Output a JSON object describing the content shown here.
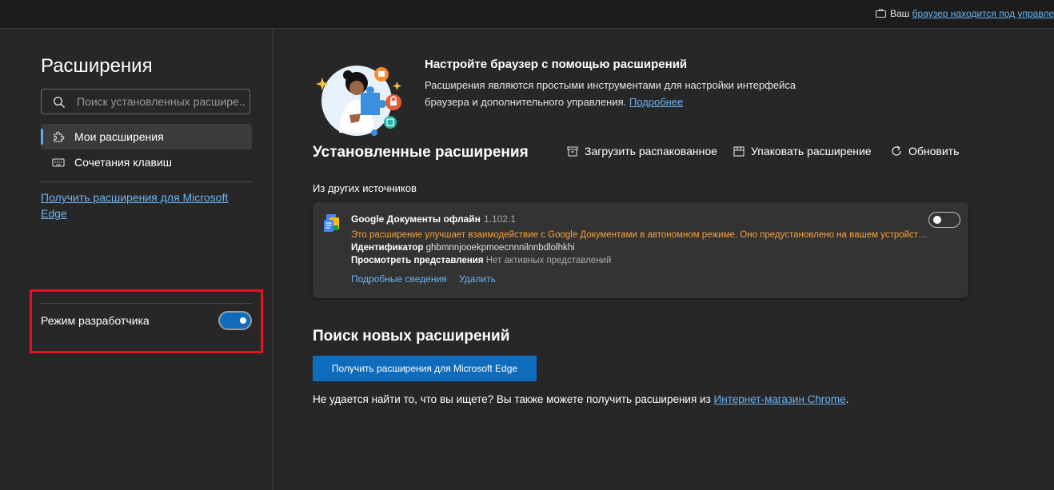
{
  "topbar": {
    "managed_prefix": "Ваш",
    "managed_link": "браузер находится под управле"
  },
  "sidebar": {
    "title": "Расширения",
    "search_placeholder": "Поиск установленных расшире...",
    "nav": [
      {
        "label": "Мои расширения",
        "icon": "puzzle-icon",
        "active": true
      },
      {
        "label": "Сочетания клавиш",
        "icon": "keyboard-icon",
        "active": false
      }
    ],
    "get_link": "Получить расширения для Microsoft Edge",
    "dev_mode_label": "Режим разработчика",
    "dev_mode_on": true
  },
  "hero": {
    "title": "Настройте браузер с помощью расширений",
    "desc": "Расширения являются простыми инструментами для настройки интерфейса браузера и дополнительного управления.",
    "more_link": "Подробнее"
  },
  "installed": {
    "title": "Установленные расширения",
    "tools": [
      {
        "label": "Загрузить распакованное",
        "icon": "load-unpacked-icon"
      },
      {
        "label": "Упаковать расширение",
        "icon": "pack-icon"
      },
      {
        "label": "Обновить",
        "icon": "refresh-icon"
      }
    ],
    "sources_label": "Из других источников"
  },
  "extension": {
    "name": "Google Документы офлайн",
    "version": "1.102.1",
    "warning": "Это расширение улучшает взаимодействие с Google Документами в автономном режиме. Оно предустановлено на вашем устройстве.",
    "id_label": "Идентификатор",
    "id_value": "ghbmnnjooekpmoecnnnilnnbdlolhkhi",
    "views_label": "Просмотреть представления",
    "views_value": "Нет активных представлений",
    "details_link": "Подробные сведения",
    "remove_link": "Удалить",
    "enabled": false
  },
  "find": {
    "title": "Поиск новых расширений",
    "button": "Получить расширения для Microsoft Edge",
    "text": "Не удается найти то, что вы ищете? Вы также можете получить расширения из",
    "store_link": "Интернет-магазин Chrome",
    "text_end": "."
  },
  "colors": {
    "accent": "#0f6cbd",
    "link": "#6cb4f5",
    "warning": "#f7a03c",
    "highlight": "#e81123"
  }
}
